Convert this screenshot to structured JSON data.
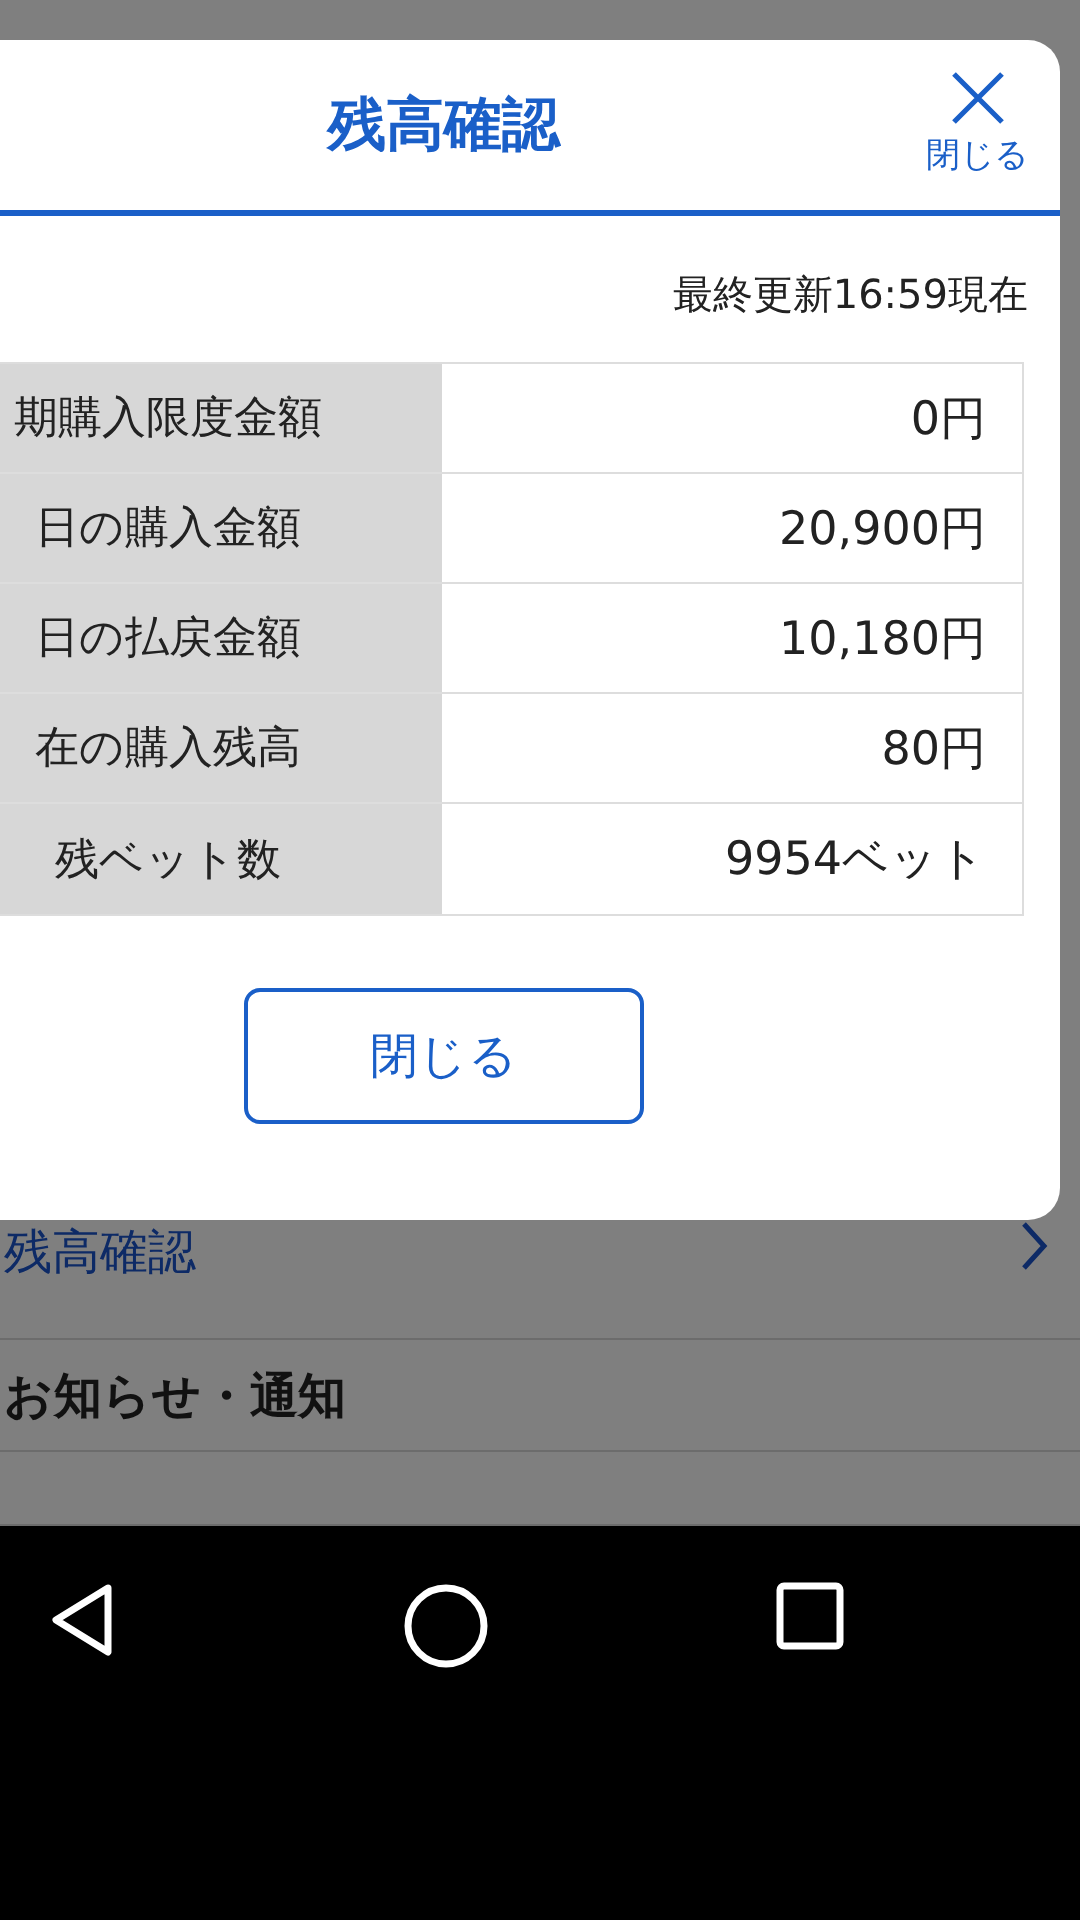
{
  "background_list": {
    "items": [
      {
        "kind": "link",
        "label": "残高確認"
      },
      {
        "kind": "header",
        "label": "お知らせ・通知"
      },
      {
        "kind": "cut_link"
      }
    ]
  },
  "dialog": {
    "title": "残高確認",
    "close_label": "閉じる",
    "updated": "最終更新16:59現在",
    "rows": [
      {
        "label": "期購入限度金額",
        "value": "0円"
      },
      {
        "label": "日の購入金額",
        "value": "20,900円"
      },
      {
        "label": "日の払戻金額",
        "value": "10,180円"
      },
      {
        "label": "在の購入残高",
        "value": "80円"
      },
      {
        "label": "残ベット数",
        "value": "9954ベット"
      }
    ],
    "button": "閉じる"
  }
}
